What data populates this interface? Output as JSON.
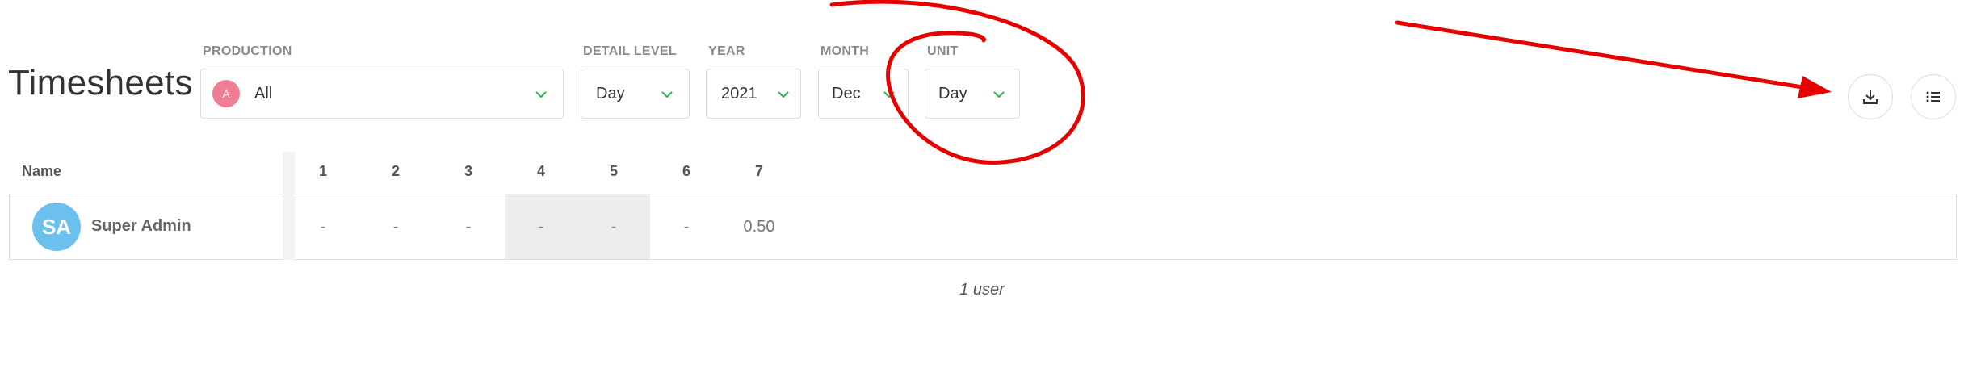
{
  "page_title": "Timesheets",
  "filters": {
    "production": {
      "label": "PRODUCTION",
      "avatar_letter": "A",
      "value": "All"
    },
    "detail_level": {
      "label": "DETAIL LEVEL",
      "value": "Day"
    },
    "year": {
      "label": "YEAR",
      "value": "2021"
    },
    "month": {
      "label": "MONTH",
      "value": "Dec"
    },
    "unit": {
      "label": "UNIT",
      "value": "Day"
    }
  },
  "actions": {
    "download_icon": "download-icon",
    "list_icon": "list-icon"
  },
  "table": {
    "name_header": "Name",
    "days": [
      "1",
      "2",
      "3",
      "4",
      "5",
      "6",
      "7"
    ],
    "rows": [
      {
        "initials": "SA",
        "name": "Super Admin",
        "cells": [
          "-",
          "-",
          "-",
          "-",
          "-",
          "-",
          "0.50"
        ]
      }
    ]
  },
  "footer": "1 user",
  "colors": {
    "accent_chevron": "#2bb24c",
    "annotation": "#e60000",
    "avatar_user": "#6cc0ee",
    "avatar_prod": "#f07d94"
  }
}
